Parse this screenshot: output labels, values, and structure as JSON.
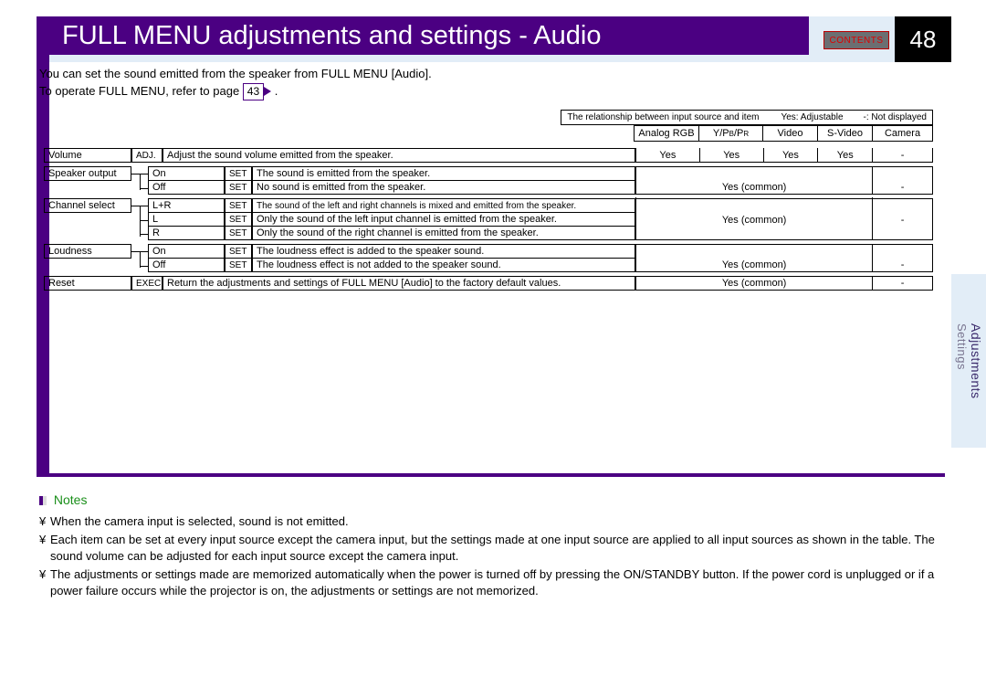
{
  "page_number": "48",
  "contents_label": "CONTENTS",
  "title": "FULL MENU adjustments and settings - Audio",
  "intro_line1": "You can set the sound emitted from the speaker from FULL MENU [Audio].",
  "intro_line2_a": "To operate FULL MENU, refer to page ",
  "page_ref": "43",
  "legend": {
    "relationship": "The relationship between input source and item",
    "yes": "Yes: Adjustable",
    "dash": "-: Not displayed"
  },
  "columns": {
    "argb": "Analog RGB",
    "ypbpr_pre": "Y/P",
    "ypbpr_b": "B",
    "ypbpr_mid": "/P",
    "ypbpr_r": "R",
    "video": "Video",
    "svideo": "S-Video",
    "camera": "Camera"
  },
  "rows": {
    "volume": {
      "item": "Volume",
      "type": "ADJ.",
      "desc": "Adjust the sound volume emitted from the speaker.",
      "a": "Yes",
      "b": "Yes",
      "c": "Yes",
      "d": "Yes",
      "e": "-"
    },
    "speaker": {
      "item": "Speaker output",
      "on": {
        "opt": "On",
        "set": "SET",
        "desc": "The sound is emitted from the speaker."
      },
      "off": {
        "opt": "Off",
        "set": "SET",
        "desc": "No sound is emitted from the speaker."
      },
      "common": "Yes (common)",
      "e": "-"
    },
    "channel": {
      "item": "Channel select",
      "lr": {
        "opt": "L+R",
        "set": "SET",
        "desc": "The sound of the left and right channels is mixed and emitted from the speaker."
      },
      "l": {
        "opt": "L",
        "set": "SET",
        "desc": "Only the sound of the left input channel is emitted from the speaker."
      },
      "r": {
        "opt": "R",
        "set": "SET",
        "desc": "Only the sound of the right channel is emitted from the speaker."
      },
      "common": "Yes (common)",
      "e": "-"
    },
    "loudness": {
      "item": "Loudness",
      "on": {
        "opt": "On",
        "set": "SET",
        "desc": "The loudness effect is added to the speaker sound."
      },
      "off": {
        "opt": "Off",
        "set": "SET",
        "desc": "The loudness effect is not added to the speaker sound."
      },
      "common": "Yes (common)",
      "e": "-"
    },
    "reset": {
      "item": "Reset",
      "type": "EXEC.",
      "desc": "Return the adjustments and settings of FULL MENU [Audio] to the factory default values.",
      "common": "Yes (common)",
      "e": "-"
    }
  },
  "side_tab": {
    "main": "Adjustments",
    "sub": "Settings"
  },
  "notes_title": "Notes",
  "bullet": "¥",
  "notes": {
    "n1": "When the camera input is selected, sound is not emitted.",
    "n2": "Each item can be set at every input source except the camera input, but the settings made at one input source are applied to all input sources as shown in the table. The sound volume can be adjusted for each input source except the camera input.",
    "n3": "The adjustments or settings made are memorized automatically when the power is turned off by pressing the ON/STANDBY button. If the power cord is unplugged or if a power failure occurs while the projector is on, the adjustments or settings are not memorized."
  }
}
